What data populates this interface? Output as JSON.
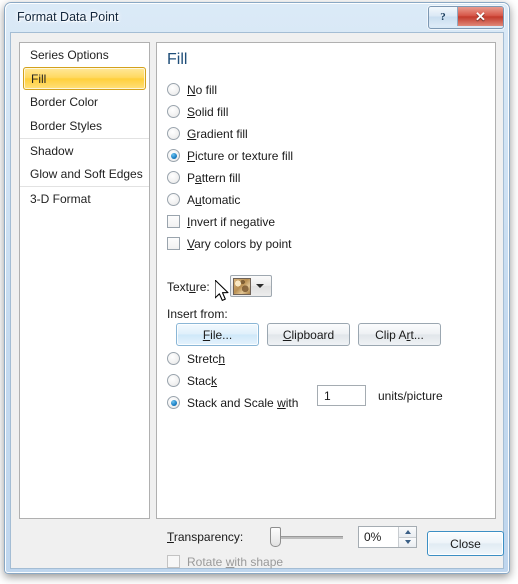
{
  "window": {
    "title": "Format Data Point",
    "help_button": "?",
    "close_button": "✕"
  },
  "sidebar": {
    "items": [
      {
        "label": "Series Options",
        "selected": false,
        "separator_before": false
      },
      {
        "label": "Fill",
        "selected": true,
        "separator_before": false
      },
      {
        "label": "Border Color",
        "selected": false,
        "separator_before": false
      },
      {
        "label": "Border Styles",
        "selected": false,
        "separator_before": false
      },
      {
        "label": "Shadow",
        "selected": false,
        "separator_before": true
      },
      {
        "label": "Glow and Soft Edges",
        "selected": false,
        "separator_before": false
      },
      {
        "label": "3-D Format",
        "selected": false,
        "separator_before": true
      }
    ]
  },
  "pane": {
    "title": "Fill",
    "fill_options": [
      {
        "label_pre": "",
        "accel": "N",
        "label_post": "o fill",
        "checked": false
      },
      {
        "label_pre": "",
        "accel": "S",
        "label_post": "olid fill",
        "checked": false
      },
      {
        "label_pre": "",
        "accel": "G",
        "label_post": "radient fill",
        "checked": false
      },
      {
        "label_pre": "",
        "accel": "P",
        "label_post": "icture or texture fill",
        "checked": true
      },
      {
        "label_pre": "P",
        "accel": "a",
        "label_post": "ttern fill",
        "checked": false
      },
      {
        "label_pre": "A",
        "accel": "u",
        "label_post": "tomatic",
        "checked": false
      }
    ],
    "checkboxes": [
      {
        "label_pre": "",
        "accel": "I",
        "label_post": "nvert if negative",
        "checked": false,
        "disabled": false
      },
      {
        "label_pre": "",
        "accel": "V",
        "label_post": "ary colors by point",
        "checked": false,
        "disabled": false
      }
    ],
    "texture": {
      "label_pre": "Text",
      "accel": "u",
      "label_post": "re:",
      "swatch_name": "papyrus-texture-swatch"
    },
    "insert_from": {
      "label": "Insert from:",
      "buttons": [
        {
          "label_pre": "",
          "accel": "F",
          "label_post": "ile...",
          "hover": true
        },
        {
          "label_pre": "",
          "accel": "C",
          "label_post": "lipboard",
          "hover": false
        },
        {
          "label_pre": "Clip A",
          "accel": "r",
          "label_post": "t...",
          "hover": false
        }
      ]
    },
    "tiling_options": [
      {
        "label_pre": "Stretc",
        "accel": "h",
        "label_post": "",
        "checked": false
      },
      {
        "label_pre": "Stac",
        "accel": "k",
        "label_post": "",
        "checked": false
      },
      {
        "label_pre": "Stack and Scale ",
        "accel": "w",
        "label_post": "ith",
        "checked": true
      }
    ],
    "scale": {
      "value": "1",
      "units_label": "units/picture"
    },
    "transparency": {
      "label_pre": "",
      "accel": "T",
      "label_post": "ransparency:",
      "value": "0%",
      "slider_position_percent": 0
    },
    "rotate_with_shape": {
      "label_pre": "Rotate ",
      "accel": "w",
      "label_post": "ith shape",
      "checked": false,
      "disabled": true
    }
  },
  "footer": {
    "close_label": "Close"
  }
}
